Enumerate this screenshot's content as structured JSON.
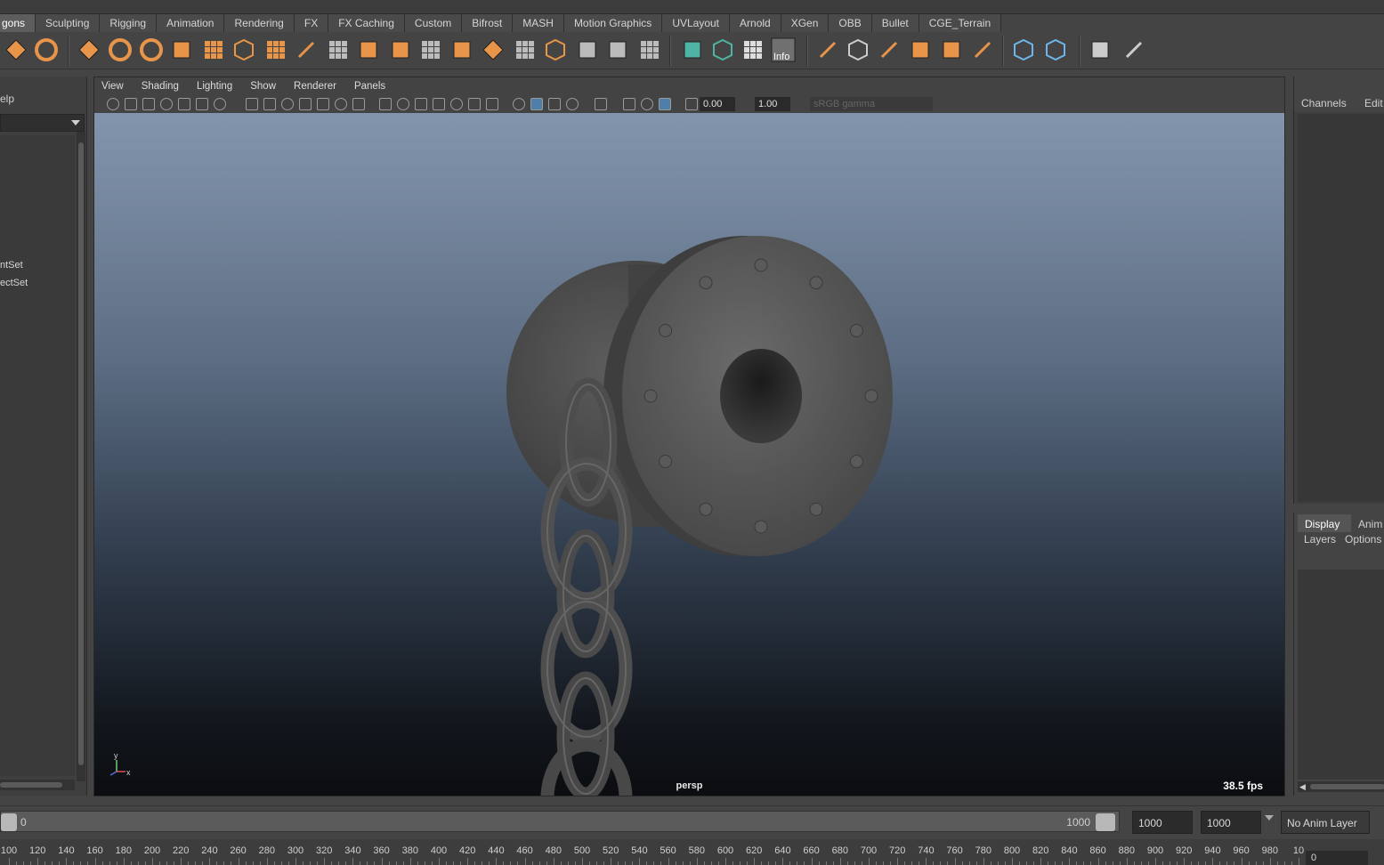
{
  "app": "Maya",
  "shelf_tabs": [
    "gons",
    "Sculpting",
    "Rigging",
    "Animation",
    "Rendering",
    "FX",
    "FX Caching",
    "Custom",
    "Bifrost",
    "MASH",
    "Motion Graphics",
    "UVLayout",
    "Arnold",
    "XGen",
    "OBB",
    "Bullet",
    "CGE_Terrain"
  ],
  "active_shelf_tab": "gons",
  "shelf_info_badge": "Info",
  "outliner": {
    "menu_fragment": "elp",
    "items": [
      "ntSet",
      "ectSet"
    ]
  },
  "viewport": {
    "menu": [
      "View",
      "Shading",
      "Lighting",
      "Show",
      "Renderer",
      "Panels"
    ],
    "exposure": "0.00",
    "gamma": "1.00",
    "color_space": "sRGB gamma",
    "camera": "persp",
    "fps": "38.5 fps",
    "axis": {
      "y": "y",
      "x": "x"
    }
  },
  "channel_box": {
    "tabs": [
      "Channels",
      "Edit"
    ]
  },
  "layer_editor": {
    "tabs": [
      "Display",
      "Anim"
    ],
    "menu": [
      "Layers",
      "Options"
    ]
  },
  "range": {
    "start": "0",
    "end_inner": "1000",
    "end": "1000",
    "max": "1000",
    "anim_layer": "No Anim Layer"
  },
  "ruler": {
    "labels": [
      "100",
      "120",
      "140",
      "160",
      "180",
      "200",
      "220",
      "240",
      "260",
      "280",
      "300",
      "320",
      "340",
      "360",
      "380",
      "400",
      "420",
      "440",
      "460",
      "480",
      "500",
      "520",
      "540",
      "560",
      "580",
      "600",
      "620",
      "640",
      "660",
      "680",
      "700",
      "720",
      "740",
      "760",
      "780",
      "800",
      "820",
      "840",
      "860",
      "880",
      "900",
      "920",
      "940",
      "960",
      "980",
      "10"
    ],
    "current_frame": "0"
  },
  "colors": {
    "accent_orange": "#e8954a",
    "accent_teal": "#4fb3a5",
    "accent_blue": "#6fb6e8"
  }
}
